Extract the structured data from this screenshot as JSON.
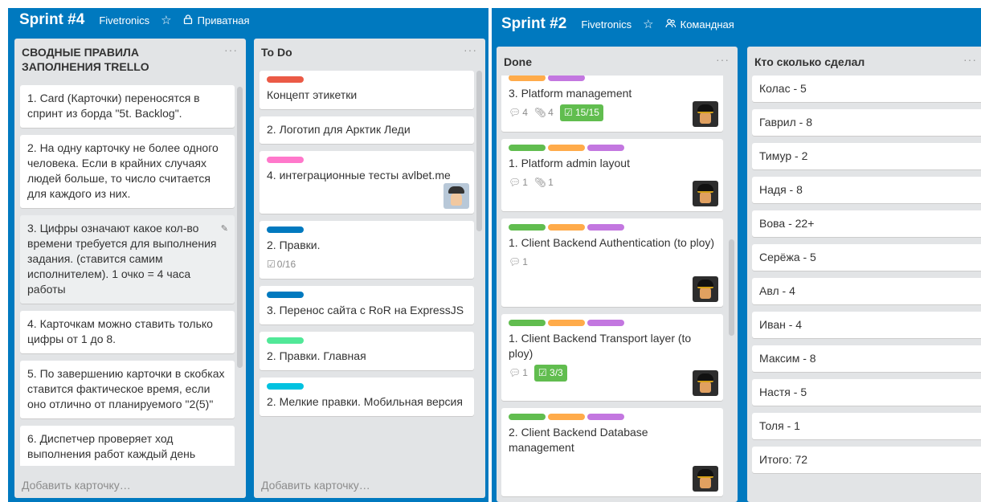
{
  "left_board": {
    "title": "Sprint #4",
    "team": "Fivetronics",
    "visibility": "Приватная",
    "lists": {
      "rules": {
        "title": "СВОДНЫЕ ПРАВИЛА ЗАПОЛНЕНИЯ TRELLO",
        "cards": [
          "1. Card (Карточки) переносятся в спринт из борда \"5t. Backlog\".",
          "2. На одну карточку не более одного человека. Если в крайних случаях людей больше, то число считается для каждого из них.",
          "3. Цифры означают какое кол-во времени требуется для выполнения задания. (ставится самим исполнителем). 1 очко = 4 часа работы",
          "4. Карточкам можно ставить только цифры от 1 до 8.",
          "5. По завершению карточки в скобках ставится фактическое время, если оно отлично от планируемого \"2(5)\"",
          "6. Диспетчер проверяет ход выполнения работ каждый день"
        ],
        "add_card": "Добавить карточку…"
      },
      "todo": {
        "title": "To Do",
        "cards": [
          {
            "title": "Концепт этикетки",
            "label_color": "#eb5a46"
          },
          {
            "title": "2. Логотип для Арктик Леди"
          },
          {
            "title": "4. интеграционные тесты avlbet.me",
            "label_color": "#ff78cb"
          },
          {
            "title": "2. Правки.",
            "label_color": "#0079bf",
            "checklist": "0/16"
          },
          {
            "title": "3. Перенос сайта с RoR на ExpressJS",
            "label_color": "#0079bf"
          },
          {
            "title": "2. Правки. Главная",
            "label_color": "#51e898"
          },
          {
            "title": "2. Мелкие правки. Мобильная версия",
            "label_color": "#00c2e0"
          }
        ],
        "add_card": "Добавить карточку…"
      }
    }
  },
  "right_board": {
    "title": "Sprint #2",
    "team": "Fivetronics",
    "visibility": "Командная",
    "lists": {
      "done": {
        "title": "Done",
        "cards": [
          {
            "title": "3. Platform management",
            "comments": "4",
            "attachments": "4",
            "checklist": "15/15"
          },
          {
            "title": "1. Platform admin layout",
            "comments": "1",
            "attachments": "1"
          },
          {
            "title": "1. Client Backend Authentication (to ploy)",
            "comments": "1"
          },
          {
            "title": "1. Client Backend Transport layer (to ploy)",
            "comments": "1",
            "checklist": "3/3"
          },
          {
            "title": "2. Client Backend Database management"
          }
        ],
        "label_colors": [
          "#61bd4f",
          "#ffab4a",
          "#c377e0"
        ]
      },
      "stats": {
        "title": "Кто сколько сделал",
        "items": [
          "Колас - 5",
          "Гаврил - 8",
          "Тимур - 2",
          "Надя - 8",
          "Вова - 22+",
          "Серёжа - 5",
          "Авл - 4",
          "Иван - 4",
          "Максим - 8",
          "Настя - 5",
          "Толя - 1",
          "Итого: 72"
        ]
      }
    }
  },
  "icons": {
    "star": "star-icon",
    "lock": "lock-icon",
    "team": "team-icon",
    "comment": "comment-icon",
    "attachment": "attachment-icon",
    "checklist": "checklist-icon",
    "menu": "list-menu-icon",
    "edit": "edit-icon"
  }
}
